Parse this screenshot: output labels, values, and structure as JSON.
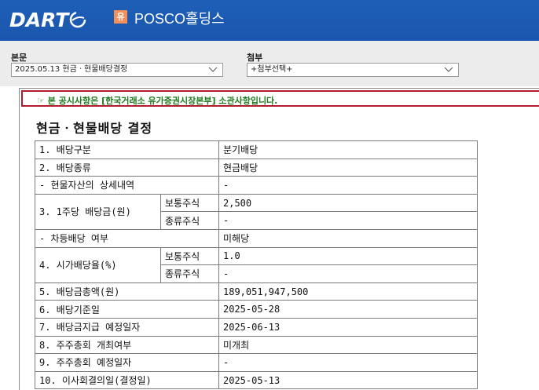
{
  "header": {
    "logo_text": "DART",
    "corp_badge": "유",
    "corp_name": "POSCO홀딩스"
  },
  "selectors": {
    "main_label": "본문",
    "main_value": "2025.05.13  현금ㆍ현물배당결정",
    "attach_label": "첨부",
    "attach_value": "+첨부선택+"
  },
  "notice": {
    "text": "☞ 본 공시사항은 [한국거래소 유가증권시장본부] 소관사항입니다."
  },
  "document": {
    "title": "현금ㆍ현물배당 결정",
    "rows": {
      "r1_label": "1. 배당구분",
      "r1_value": "분기배당",
      "r2_label": "2. 배당종류",
      "r2_value": "현금배당",
      "r3_label": "- 현물자산의 상세내역",
      "r3_value": "-",
      "r4_label": "3. 1주당 배당금(원)",
      "r4_sub1": "보통주식",
      "r4_val1": "2,500",
      "r4_sub2": "종류주식",
      "r4_val2": "-",
      "r5_label": "- 차등배당 여부",
      "r5_value": "미해당",
      "r6_label": "4. 시가배당율(%)",
      "r6_sub1": "보통주식",
      "r6_val1": "1.0",
      "r6_sub2": "종류주식",
      "r6_val2": "-",
      "r7_label": "5. 배당금총액(원)",
      "r7_value": "189,051,947,500",
      "r8_label": "6. 배당기준일",
      "r8_value": "2025-05-28",
      "r9_label": "7. 배당금지급 예정일자",
      "r9_value": "2025-06-13",
      "r10_label": "8. 주주총회 개최여부",
      "r10_value": "미개최",
      "r11_label": "9. 주주총회 예정일자",
      "r11_value": "-",
      "r12_label": "10. 이사회결의일(결정일)",
      "r12_value": "2025-05-13"
    }
  }
}
